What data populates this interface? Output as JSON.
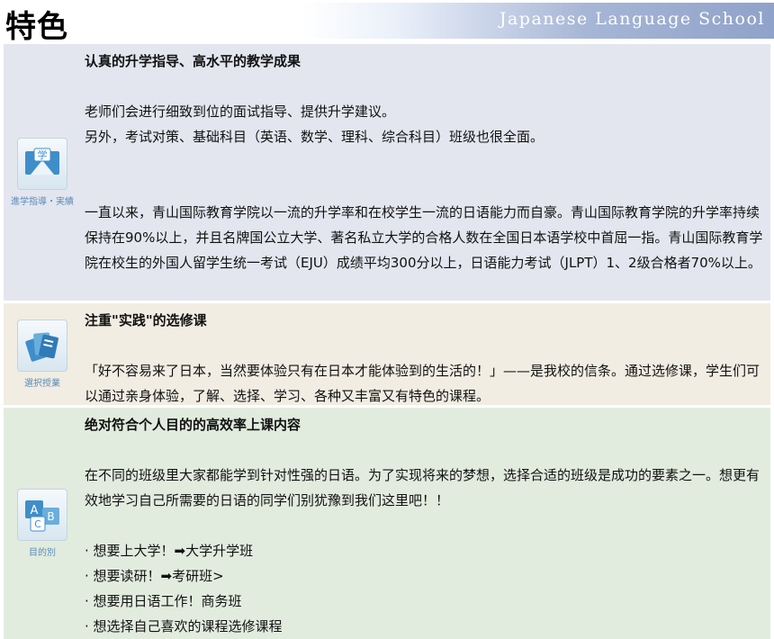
{
  "page": {
    "title": "特色",
    "banner": "Japanese Language School"
  },
  "sections": [
    {
      "icon_caption": "進学指導・実績",
      "heading": "认真的升学指导、高水平的教学成果",
      "p1": "老师们会进行细致到位的面试指导、提供升学建议。",
      "p2": "另外，考试对策、基础科目（英语、数学、理科、综合科目）班级也很全面。",
      "p3": "一直以来，青山国际教育学院以一流的升学率和在校学生一流的日语能力而自豪。青山国际教育学院的升学率持续保持在90%以上，并且名牌国公立大学、著名私立大学的合格人数在全国日本语学校中首屈一指。青山国际教育学院在校生的外国人留学生统一考试（EJU）成绩平均300分以上，日语能力考试（JLPT）1、2级合格者70%以上。"
    },
    {
      "icon_caption": "選択授業",
      "heading": "注重\"实践\"的选修课",
      "p1": "「好不容易来了日本，当然要体验只有在日本才能体验到的生活的！」——是我校的信条。通过选修课，学生们可以通过亲身体验，了解、选择、学习、各种又丰富又有特色的课程。"
    },
    {
      "icon_caption": "目的別",
      "heading": "绝对符合个人目的的高效率上课内容",
      "p1": "在不同的班级里大家都能学到针对性强的日语。为了实现将来的梦想，选择合适的班级是成功的要素之一。想更有效地学习自己所需要的日语的同学们别犹豫到我们这里吧！！",
      "bullets": [
        "想要上大学！➡大学升学班",
        "想要读研！➡考研班>",
        "想要用日语工作！商务班",
        "想选择自己喜欢的课程选修课程"
      ]
    }
  ]
}
